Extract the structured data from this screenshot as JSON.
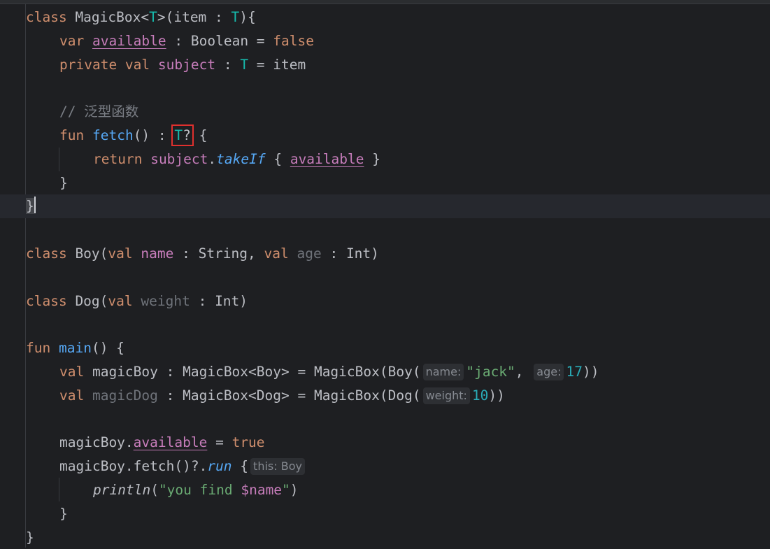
{
  "colors": {
    "background": "#1e1f22",
    "keyword": "#cf8e6d",
    "function": "#56a8f5",
    "property": "#c77dbb",
    "type_param": "#16baac",
    "number": "#2aacb8",
    "string": "#6aab73",
    "comment": "#7a7e85",
    "highlight_box": "#e0302e"
  },
  "code": {
    "l1": {
      "kw": "class",
      "name": " MagicBox<",
      "tp": "T",
      "rest": ">(item : ",
      "tp2": "T",
      "end": "){"
    },
    "l2": {
      "kw": "var",
      "prop": "available",
      "mid": " : Boolean = ",
      "kw2": "false"
    },
    "l3": {
      "kw": "private val",
      "prop": "subject",
      "mid": " : ",
      "tp": "T",
      "end": " = item"
    },
    "l5": {
      "comment": "// 泛型函数"
    },
    "l6": {
      "kw": "fun",
      "fn": "fetch",
      "mid": "() : ",
      "tp": "T",
      "q": "?",
      "end": " {"
    },
    "l7": {
      "kw": "return",
      "prop": "subject",
      "dot": ".",
      "fn": "takeIf",
      "open": " { ",
      "prop2": "available",
      "close": " }"
    },
    "l8": {
      "text": "}"
    },
    "l9": {
      "text": "}"
    },
    "l11": {
      "kw": "class",
      "name": " Boy(",
      "kw2": "val",
      "prop": "name",
      "mid": " : String, ",
      "kw3": "val",
      "unused": "age",
      "end": " : Int)"
    },
    "l13": {
      "kw": "class",
      "name": " Dog(",
      "kw2": "val",
      "unused": "weight",
      "end": " : Int)"
    },
    "l15": {
      "kw": "fun",
      "fn": "main",
      "end": "() {"
    },
    "l16": {
      "kw": "val",
      "var": " magicBoy : MagicBox<Boy> = MagicBox(Boy(",
      "hint1": "name:",
      "str": "\"jack\"",
      "comma": ", ",
      "hint2": "age:",
      "num": "17",
      "end": "))"
    },
    "l17": {
      "kw": "val",
      "unused": "magicDog",
      "mid": " : MagicBox<Dog> = MagicBox(Dog(",
      "hint": "weight:",
      "num": "10",
      "end": "))"
    },
    "l19": {
      "pre": "magicBoy.",
      "prop": "available",
      "mid": " = ",
      "kw": "true"
    },
    "l20": {
      "pre": "magicBoy.fetch()?.",
      "fn": "run",
      "open": " {",
      "hint": "this: Boy"
    },
    "l21": {
      "fn": "println",
      "open": "(",
      "str": "\"you find ",
      "tmpl": "$name",
      "strend": "\"",
      "close": ")"
    },
    "l22": {
      "text": "}"
    },
    "l23": {
      "text": "}"
    }
  }
}
